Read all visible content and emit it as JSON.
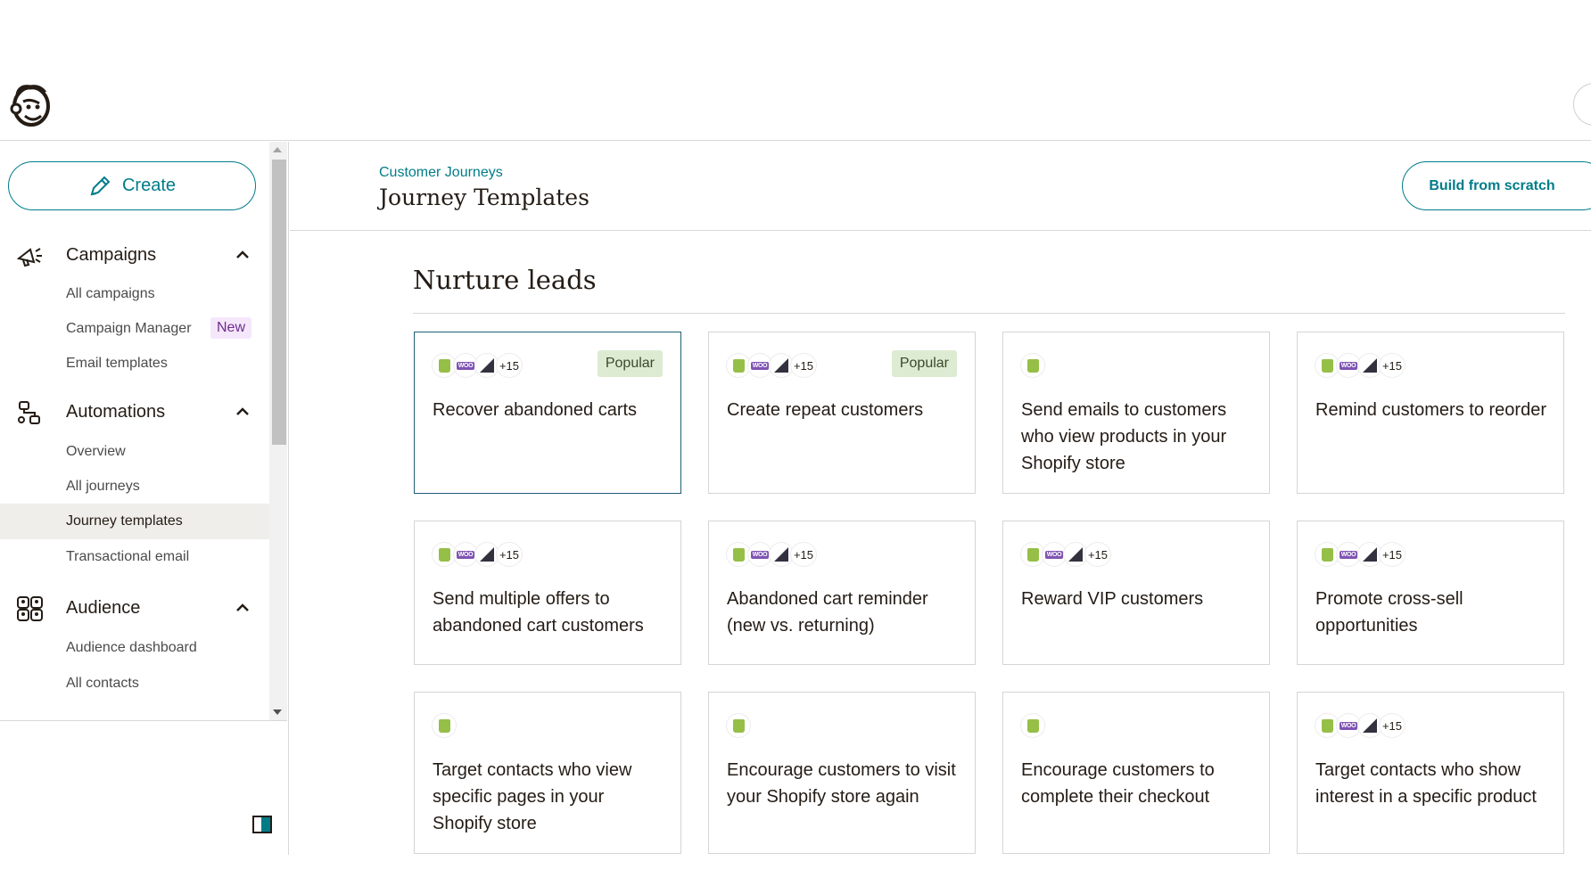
{
  "sidebar": {
    "create_label": "Create",
    "sections": [
      {
        "label": "Campaigns",
        "items": [
          {
            "label": "All campaigns"
          },
          {
            "label": "Campaign Manager",
            "badge": "New"
          },
          {
            "label": "Email templates"
          }
        ]
      },
      {
        "label": "Automations",
        "items": [
          {
            "label": "Overview"
          },
          {
            "label": "All journeys"
          },
          {
            "label": "Journey templates",
            "active": true
          },
          {
            "label": "Transactional email"
          }
        ]
      },
      {
        "label": "Audience",
        "items": [
          {
            "label": "Audience dashboard"
          },
          {
            "label": "All contacts"
          }
        ]
      }
    ]
  },
  "header": {
    "breadcrumb": "Customer Journeys",
    "title": "Journey Templates",
    "build_button": "Build from scratch"
  },
  "section": {
    "title": "Nurture leads"
  },
  "integrations_more": "+15",
  "popular_label": "Popular",
  "cards": [
    {
      "title": "Recover abandoned carts",
      "icons": "multi",
      "popular": true,
      "selected": true
    },
    {
      "title": "Create repeat customers",
      "icons": "multi",
      "popular": true
    },
    {
      "title": "Send emails to customers who view products in your Shopify store",
      "icons": "shopify"
    },
    {
      "title": "Remind customers to reorder",
      "icons": "multi"
    },
    {
      "title": "Send multiple offers to abandoned cart customers",
      "icons": "multi"
    },
    {
      "title": "Abandoned cart reminder (new vs. returning)",
      "icons": "multi"
    },
    {
      "title": "Reward VIP customers",
      "icons": "multi"
    },
    {
      "title": "Promote cross-sell opportunities",
      "icons": "multi"
    },
    {
      "title": "Target contacts who view specific pages in your Shopify store",
      "icons": "shopify"
    },
    {
      "title": "Encourage customers to visit your Shopify store again",
      "icons": "shopify"
    },
    {
      "title": "Encourage customers to complete their checkout",
      "icons": "shopify"
    },
    {
      "title": "Target contacts who show interest in a specific product",
      "icons": "multi"
    }
  ],
  "colors": {
    "accent": "#007c89",
    "text": "#241c15",
    "popular_bg": "#ddebd2",
    "new_badge_bg": "#f5e7fb"
  }
}
